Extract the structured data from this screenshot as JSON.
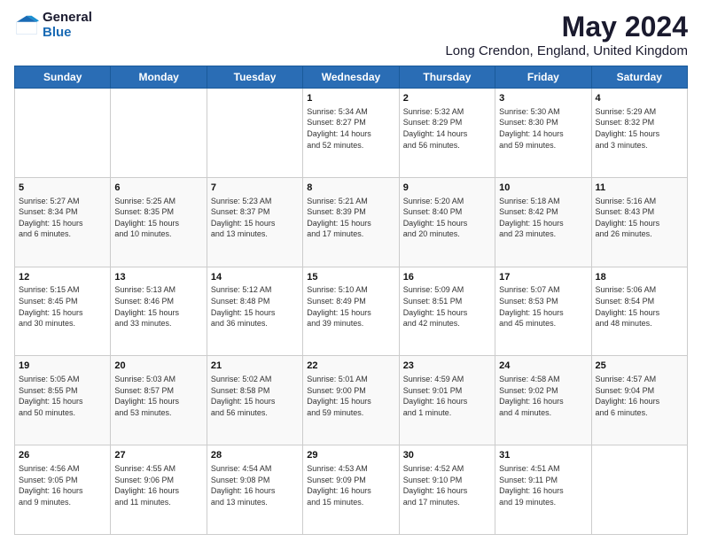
{
  "logo": {
    "general": "General",
    "blue": "Blue"
  },
  "title": "May 2024",
  "location": "Long Crendon, England, United Kingdom",
  "weekdays": [
    "Sunday",
    "Monday",
    "Tuesday",
    "Wednesday",
    "Thursday",
    "Friday",
    "Saturday"
  ],
  "weeks": [
    [
      {
        "day": "",
        "info": ""
      },
      {
        "day": "",
        "info": ""
      },
      {
        "day": "",
        "info": ""
      },
      {
        "day": "1",
        "info": "Sunrise: 5:34 AM\nSunset: 8:27 PM\nDaylight: 14 hours\nand 52 minutes."
      },
      {
        "day": "2",
        "info": "Sunrise: 5:32 AM\nSunset: 8:29 PM\nDaylight: 14 hours\nand 56 minutes."
      },
      {
        "day": "3",
        "info": "Sunrise: 5:30 AM\nSunset: 8:30 PM\nDaylight: 14 hours\nand 59 minutes."
      },
      {
        "day": "4",
        "info": "Sunrise: 5:29 AM\nSunset: 8:32 PM\nDaylight: 15 hours\nand 3 minutes."
      }
    ],
    [
      {
        "day": "5",
        "info": "Sunrise: 5:27 AM\nSunset: 8:34 PM\nDaylight: 15 hours\nand 6 minutes."
      },
      {
        "day": "6",
        "info": "Sunrise: 5:25 AM\nSunset: 8:35 PM\nDaylight: 15 hours\nand 10 minutes."
      },
      {
        "day": "7",
        "info": "Sunrise: 5:23 AM\nSunset: 8:37 PM\nDaylight: 15 hours\nand 13 minutes."
      },
      {
        "day": "8",
        "info": "Sunrise: 5:21 AM\nSunset: 8:39 PM\nDaylight: 15 hours\nand 17 minutes."
      },
      {
        "day": "9",
        "info": "Sunrise: 5:20 AM\nSunset: 8:40 PM\nDaylight: 15 hours\nand 20 minutes."
      },
      {
        "day": "10",
        "info": "Sunrise: 5:18 AM\nSunset: 8:42 PM\nDaylight: 15 hours\nand 23 minutes."
      },
      {
        "day": "11",
        "info": "Sunrise: 5:16 AM\nSunset: 8:43 PM\nDaylight: 15 hours\nand 26 minutes."
      }
    ],
    [
      {
        "day": "12",
        "info": "Sunrise: 5:15 AM\nSunset: 8:45 PM\nDaylight: 15 hours\nand 30 minutes."
      },
      {
        "day": "13",
        "info": "Sunrise: 5:13 AM\nSunset: 8:46 PM\nDaylight: 15 hours\nand 33 minutes."
      },
      {
        "day": "14",
        "info": "Sunrise: 5:12 AM\nSunset: 8:48 PM\nDaylight: 15 hours\nand 36 minutes."
      },
      {
        "day": "15",
        "info": "Sunrise: 5:10 AM\nSunset: 8:49 PM\nDaylight: 15 hours\nand 39 minutes."
      },
      {
        "day": "16",
        "info": "Sunrise: 5:09 AM\nSunset: 8:51 PM\nDaylight: 15 hours\nand 42 minutes."
      },
      {
        "day": "17",
        "info": "Sunrise: 5:07 AM\nSunset: 8:53 PM\nDaylight: 15 hours\nand 45 minutes."
      },
      {
        "day": "18",
        "info": "Sunrise: 5:06 AM\nSunset: 8:54 PM\nDaylight: 15 hours\nand 48 minutes."
      }
    ],
    [
      {
        "day": "19",
        "info": "Sunrise: 5:05 AM\nSunset: 8:55 PM\nDaylight: 15 hours\nand 50 minutes."
      },
      {
        "day": "20",
        "info": "Sunrise: 5:03 AM\nSunset: 8:57 PM\nDaylight: 15 hours\nand 53 minutes."
      },
      {
        "day": "21",
        "info": "Sunrise: 5:02 AM\nSunset: 8:58 PM\nDaylight: 15 hours\nand 56 minutes."
      },
      {
        "day": "22",
        "info": "Sunrise: 5:01 AM\nSunset: 9:00 PM\nDaylight: 15 hours\nand 59 minutes."
      },
      {
        "day": "23",
        "info": "Sunrise: 4:59 AM\nSunset: 9:01 PM\nDaylight: 16 hours\nand 1 minute."
      },
      {
        "day": "24",
        "info": "Sunrise: 4:58 AM\nSunset: 9:02 PM\nDaylight: 16 hours\nand 4 minutes."
      },
      {
        "day": "25",
        "info": "Sunrise: 4:57 AM\nSunset: 9:04 PM\nDaylight: 16 hours\nand 6 minutes."
      }
    ],
    [
      {
        "day": "26",
        "info": "Sunrise: 4:56 AM\nSunset: 9:05 PM\nDaylight: 16 hours\nand 9 minutes."
      },
      {
        "day": "27",
        "info": "Sunrise: 4:55 AM\nSunset: 9:06 PM\nDaylight: 16 hours\nand 11 minutes."
      },
      {
        "day": "28",
        "info": "Sunrise: 4:54 AM\nSunset: 9:08 PM\nDaylight: 16 hours\nand 13 minutes."
      },
      {
        "day": "29",
        "info": "Sunrise: 4:53 AM\nSunset: 9:09 PM\nDaylight: 16 hours\nand 15 minutes."
      },
      {
        "day": "30",
        "info": "Sunrise: 4:52 AM\nSunset: 9:10 PM\nDaylight: 16 hours\nand 17 minutes."
      },
      {
        "day": "31",
        "info": "Sunrise: 4:51 AM\nSunset: 9:11 PM\nDaylight: 16 hours\nand 19 minutes."
      },
      {
        "day": "",
        "info": ""
      }
    ]
  ]
}
